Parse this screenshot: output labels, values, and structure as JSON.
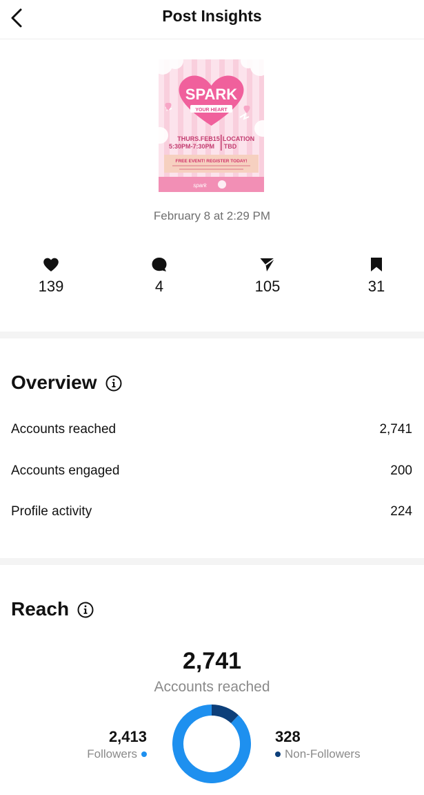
{
  "header": {
    "title": "Post Insights",
    "back_icon": "chevron-left-icon"
  },
  "post": {
    "date": "February 8 at 2:29 PM",
    "thumbnail": {
      "headline": "SPARK",
      "subhead": "YOUR HEART",
      "date_line": "THURS.FEB15",
      "time_line": "5:30PM-7:30PM",
      "location_line": "LOCATION",
      "location_value": "TBD",
      "banner": "FREE EVENT! REGISTER TODAY!",
      "brand": "spark",
      "colors": {
        "bg": "#fce3ec",
        "heart": "#f0609c",
        "stripe": "#f9cfdd",
        "banner": "#f6d0c0"
      }
    }
  },
  "stats": [
    {
      "icon": "heart-icon",
      "value": "139"
    },
    {
      "icon": "comment-icon",
      "value": "4"
    },
    {
      "icon": "share-icon",
      "value": "105"
    },
    {
      "icon": "bookmark-icon",
      "value": "31"
    }
  ],
  "overview": {
    "title": "Overview",
    "rows": [
      {
        "label": "Accounts reached",
        "value": "2,741"
      },
      {
        "label": "Accounts engaged",
        "value": "200"
      },
      {
        "label": "Profile activity",
        "value": "224"
      }
    ]
  },
  "reach": {
    "title": "Reach",
    "total": "2,741",
    "total_label": "Accounts reached",
    "followers": {
      "value": "2,413",
      "label": "Followers",
      "color": "#1e90ef"
    },
    "non_followers": {
      "value": "328",
      "label": "Non-Followers",
      "color": "#0d3f7a"
    }
  }
}
